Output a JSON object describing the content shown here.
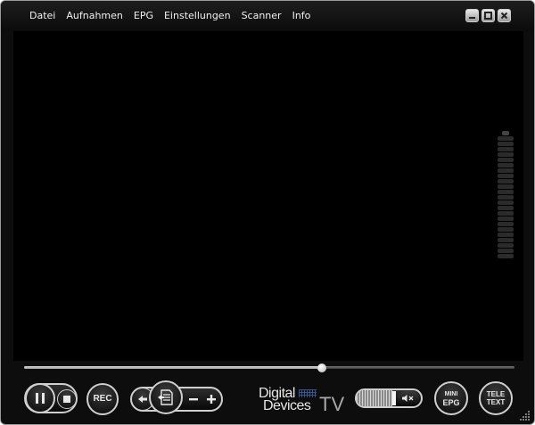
{
  "menu": {
    "items": [
      "Datei",
      "Aufnahmen",
      "EPG",
      "Einstellungen",
      "Scanner",
      "Info"
    ]
  },
  "window_controls": {
    "minimize": "minimize-icon",
    "maximize": "maximize-icon",
    "close": "close-icon"
  },
  "seek": {
    "position_fraction": 0.607
  },
  "controls": {
    "rec_label": "REC",
    "brand_line1": "Digital",
    "brand_line2": "Devices",
    "brand_tv": "TV",
    "volume_level_fraction": 0.8,
    "mini_epg_line1": "MINI",
    "mini_epg_line2": "EPG",
    "teletext_line1": "TELE",
    "teletext_line2": "TEXT"
  },
  "icons": [
    "pause-icon",
    "stop-icon",
    "back-arrow-icon",
    "document-icon",
    "minus-icon",
    "plus-icon",
    "speaker-mute-icon"
  ],
  "colors": {
    "background": "#000000",
    "chrome": "#0d0d0d",
    "text": "#f0f0f0",
    "accent": "#3a5f9a"
  }
}
